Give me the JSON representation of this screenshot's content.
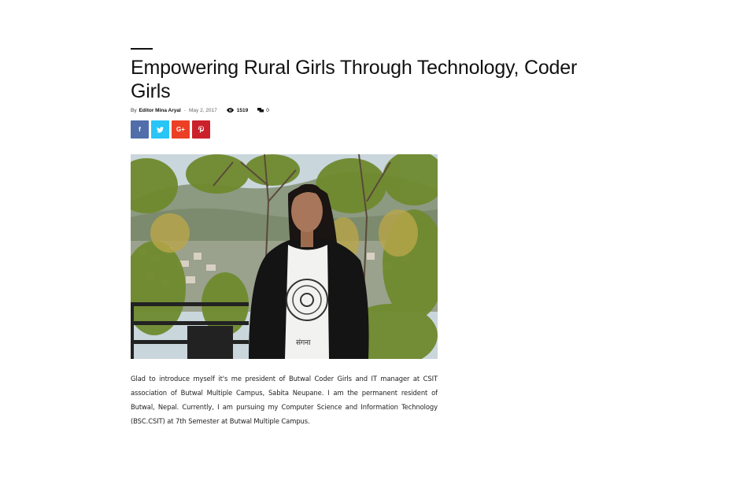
{
  "article": {
    "title": "Empowering Rural Girls Through Technology, Coder Girls",
    "meta": {
      "by_label": "By",
      "author": "Editor Mina Aryal",
      "separator": "-",
      "date": "May 2, 2017",
      "views": "1519",
      "comments": "0"
    },
    "share": [
      {
        "name": "facebook",
        "glyph": "f",
        "color": "#516eab"
      },
      {
        "name": "twitter",
        "glyph": "t",
        "color": "#29c5f6"
      },
      {
        "name": "google-plus",
        "glyph": "G+",
        "color": "#eb4026"
      },
      {
        "name": "pinterest",
        "glyph": "P",
        "color": "#ca212a"
      }
    ],
    "photo_caption_text": "संगना",
    "body": "Glad to introduce myself it's me president of Butwal Coder Girls and IT manager at CSIT association of Butwal Multiple Campus, Sabita Neupane. I am the permanent resident of Butwal, Nepal. Currently, I am pursuing my Computer Science and Information Technology (BSC.CSIT) at 7th Semester at Butwal Multiple Campus."
  }
}
